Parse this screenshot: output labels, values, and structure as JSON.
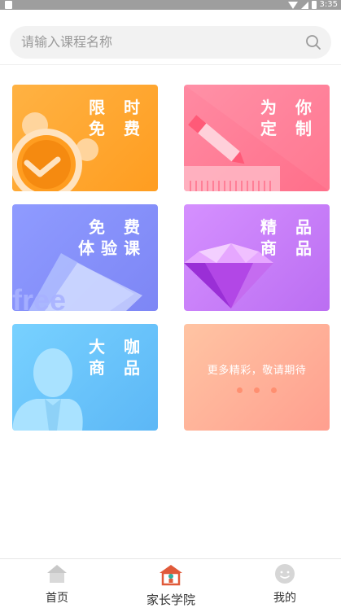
{
  "status_bar": {
    "time": "3:35"
  },
  "search": {
    "placeholder": "请输入课程名称"
  },
  "cards": [
    {
      "title": "限 时\n免 费",
      "colors": [
        "#ffb243",
        "#ff9d20"
      ]
    },
    {
      "title": "为 你\n定 制",
      "colors": [
        "#ff8aa2",
        "#ff6f8a"
      ]
    },
    {
      "title": "免 费\n体验课",
      "watermark": "free",
      "colors": [
        "#8f9bff",
        "#7d86f5"
      ]
    },
    {
      "title": "精 品\n商 品",
      "colors": [
        "#d590ff",
        "#bb6ef2"
      ]
    },
    {
      "title": "大 咖\n商 品",
      "colors": [
        "#78d1ff",
        "#5cb7f6"
      ]
    },
    {
      "title": "更多精彩，敬请期待",
      "colors": [
        "#ffc4a3",
        "#ff9f8f"
      ]
    }
  ],
  "bottom_nav": {
    "items": [
      {
        "label": "首页",
        "icon": "home-icon",
        "active": false
      },
      {
        "label": "家长学院",
        "icon": "school-icon",
        "active": true
      },
      {
        "label": "我的",
        "icon": "smile-icon",
        "active": false
      }
    ],
    "active_color": "#e05a3a",
    "inactive_color": "#c8c8c8"
  }
}
